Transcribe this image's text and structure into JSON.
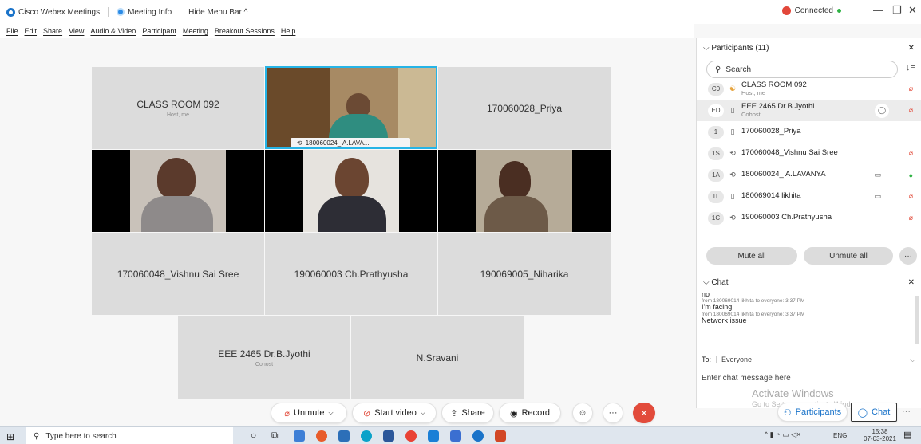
{
  "titlebar": {
    "app_name": "Cisco Webex Meetings",
    "meeting_info": "Meeting Info",
    "hide_menu": "Hide Menu Bar ^",
    "connection": "Connected",
    "minimize": "—",
    "maximize": "❐",
    "close": "✕"
  },
  "menu": [
    "File",
    "Edit",
    "Share",
    "View",
    "Audio & Video",
    "Participant",
    "Meeting",
    "Breakout Sessions",
    "Help"
  ],
  "tiles": {
    "classroom": {
      "name": "CLASS ROOM 092",
      "sub": "Host, me"
    },
    "lavanya": {
      "name": "180060024_ A.LAVA..."
    },
    "priya": {
      "name": "170060028_Priya"
    },
    "vishnu": {
      "name": "170060048_Vishnu Sai Sree"
    },
    "prathyusha": {
      "name": "190060003 Ch.Prathyusha"
    },
    "niharika": {
      "name": "190069005_Niharika"
    },
    "jyothi": {
      "name": "EEE 2465 Dr.B.Jyothi",
      "sub": "Cohost"
    },
    "sravani": {
      "name": "N.Sravani"
    }
  },
  "participants": {
    "header": "Participants (11)",
    "search_placeholder": "Search",
    "rows": [
      {
        "initials": "C0",
        "name": "CLASS ROOM 092",
        "sub": "Host, me"
      },
      {
        "initials": "ED",
        "name": "EEE 2465 Dr.B.Jyothi",
        "sub": "Cohost"
      },
      {
        "initials": "1",
        "name": "170060028_Priya",
        "sub": ""
      },
      {
        "initials": "1S",
        "name": "170060048_Vishnu Sai Sree",
        "sub": ""
      },
      {
        "initials": "1A",
        "name": "180060024_ A.LAVANYA",
        "sub": ""
      },
      {
        "initials": "1L",
        "name": "180069014 likhita",
        "sub": ""
      },
      {
        "initials": "1C",
        "name": "190060003 Ch.Prathyusha",
        "sub": ""
      }
    ],
    "mute_all": "Mute all",
    "unmute_all": "Unmute all",
    "more": "···"
  },
  "chat": {
    "header": "Chat",
    "messages": [
      {
        "text": "no",
        "meta": ""
      },
      {
        "text": "I'm facing",
        "meta": "from 180069014 likhita to everyone:   3:37 PM"
      },
      {
        "text": "Network issue",
        "meta": "from 180069014 likhita to everyone:   3:37 PM"
      }
    ],
    "to_label": "To:",
    "to_value": "Everyone",
    "input_placeholder": "Enter chat message here"
  },
  "toolbar": {
    "unmute": "Unmute",
    "start_video": "Start video",
    "share": "Share",
    "record": "Record",
    "participants": "Participants",
    "chat": "Chat",
    "more": "···"
  },
  "watermark": {
    "line1": "Activate Windows",
    "line2": "Go to Settings to activate Windows."
  },
  "taskbar": {
    "search": "Type here to search",
    "lang": "ENG",
    "time": "15:38",
    "date": "07-03-2021"
  }
}
